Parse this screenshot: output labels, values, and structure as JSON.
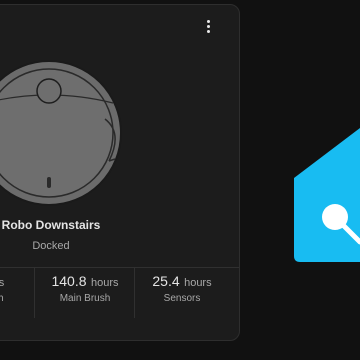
{
  "card": {
    "menu_icon": "more-vertical-icon",
    "name": "Robo Downstairs",
    "status": "Docked",
    "stats": [
      {
        "value": "",
        "unit": "hours",
        "label": "Brush"
      },
      {
        "value": "140.8",
        "unit": "hours",
        "label": "Main Brush"
      },
      {
        "value": "25.4",
        "unit": "hours",
        "label": "Sensors"
      }
    ]
  },
  "logo": {
    "icon": "home-assistant-logo",
    "color": "#18bcf2"
  }
}
